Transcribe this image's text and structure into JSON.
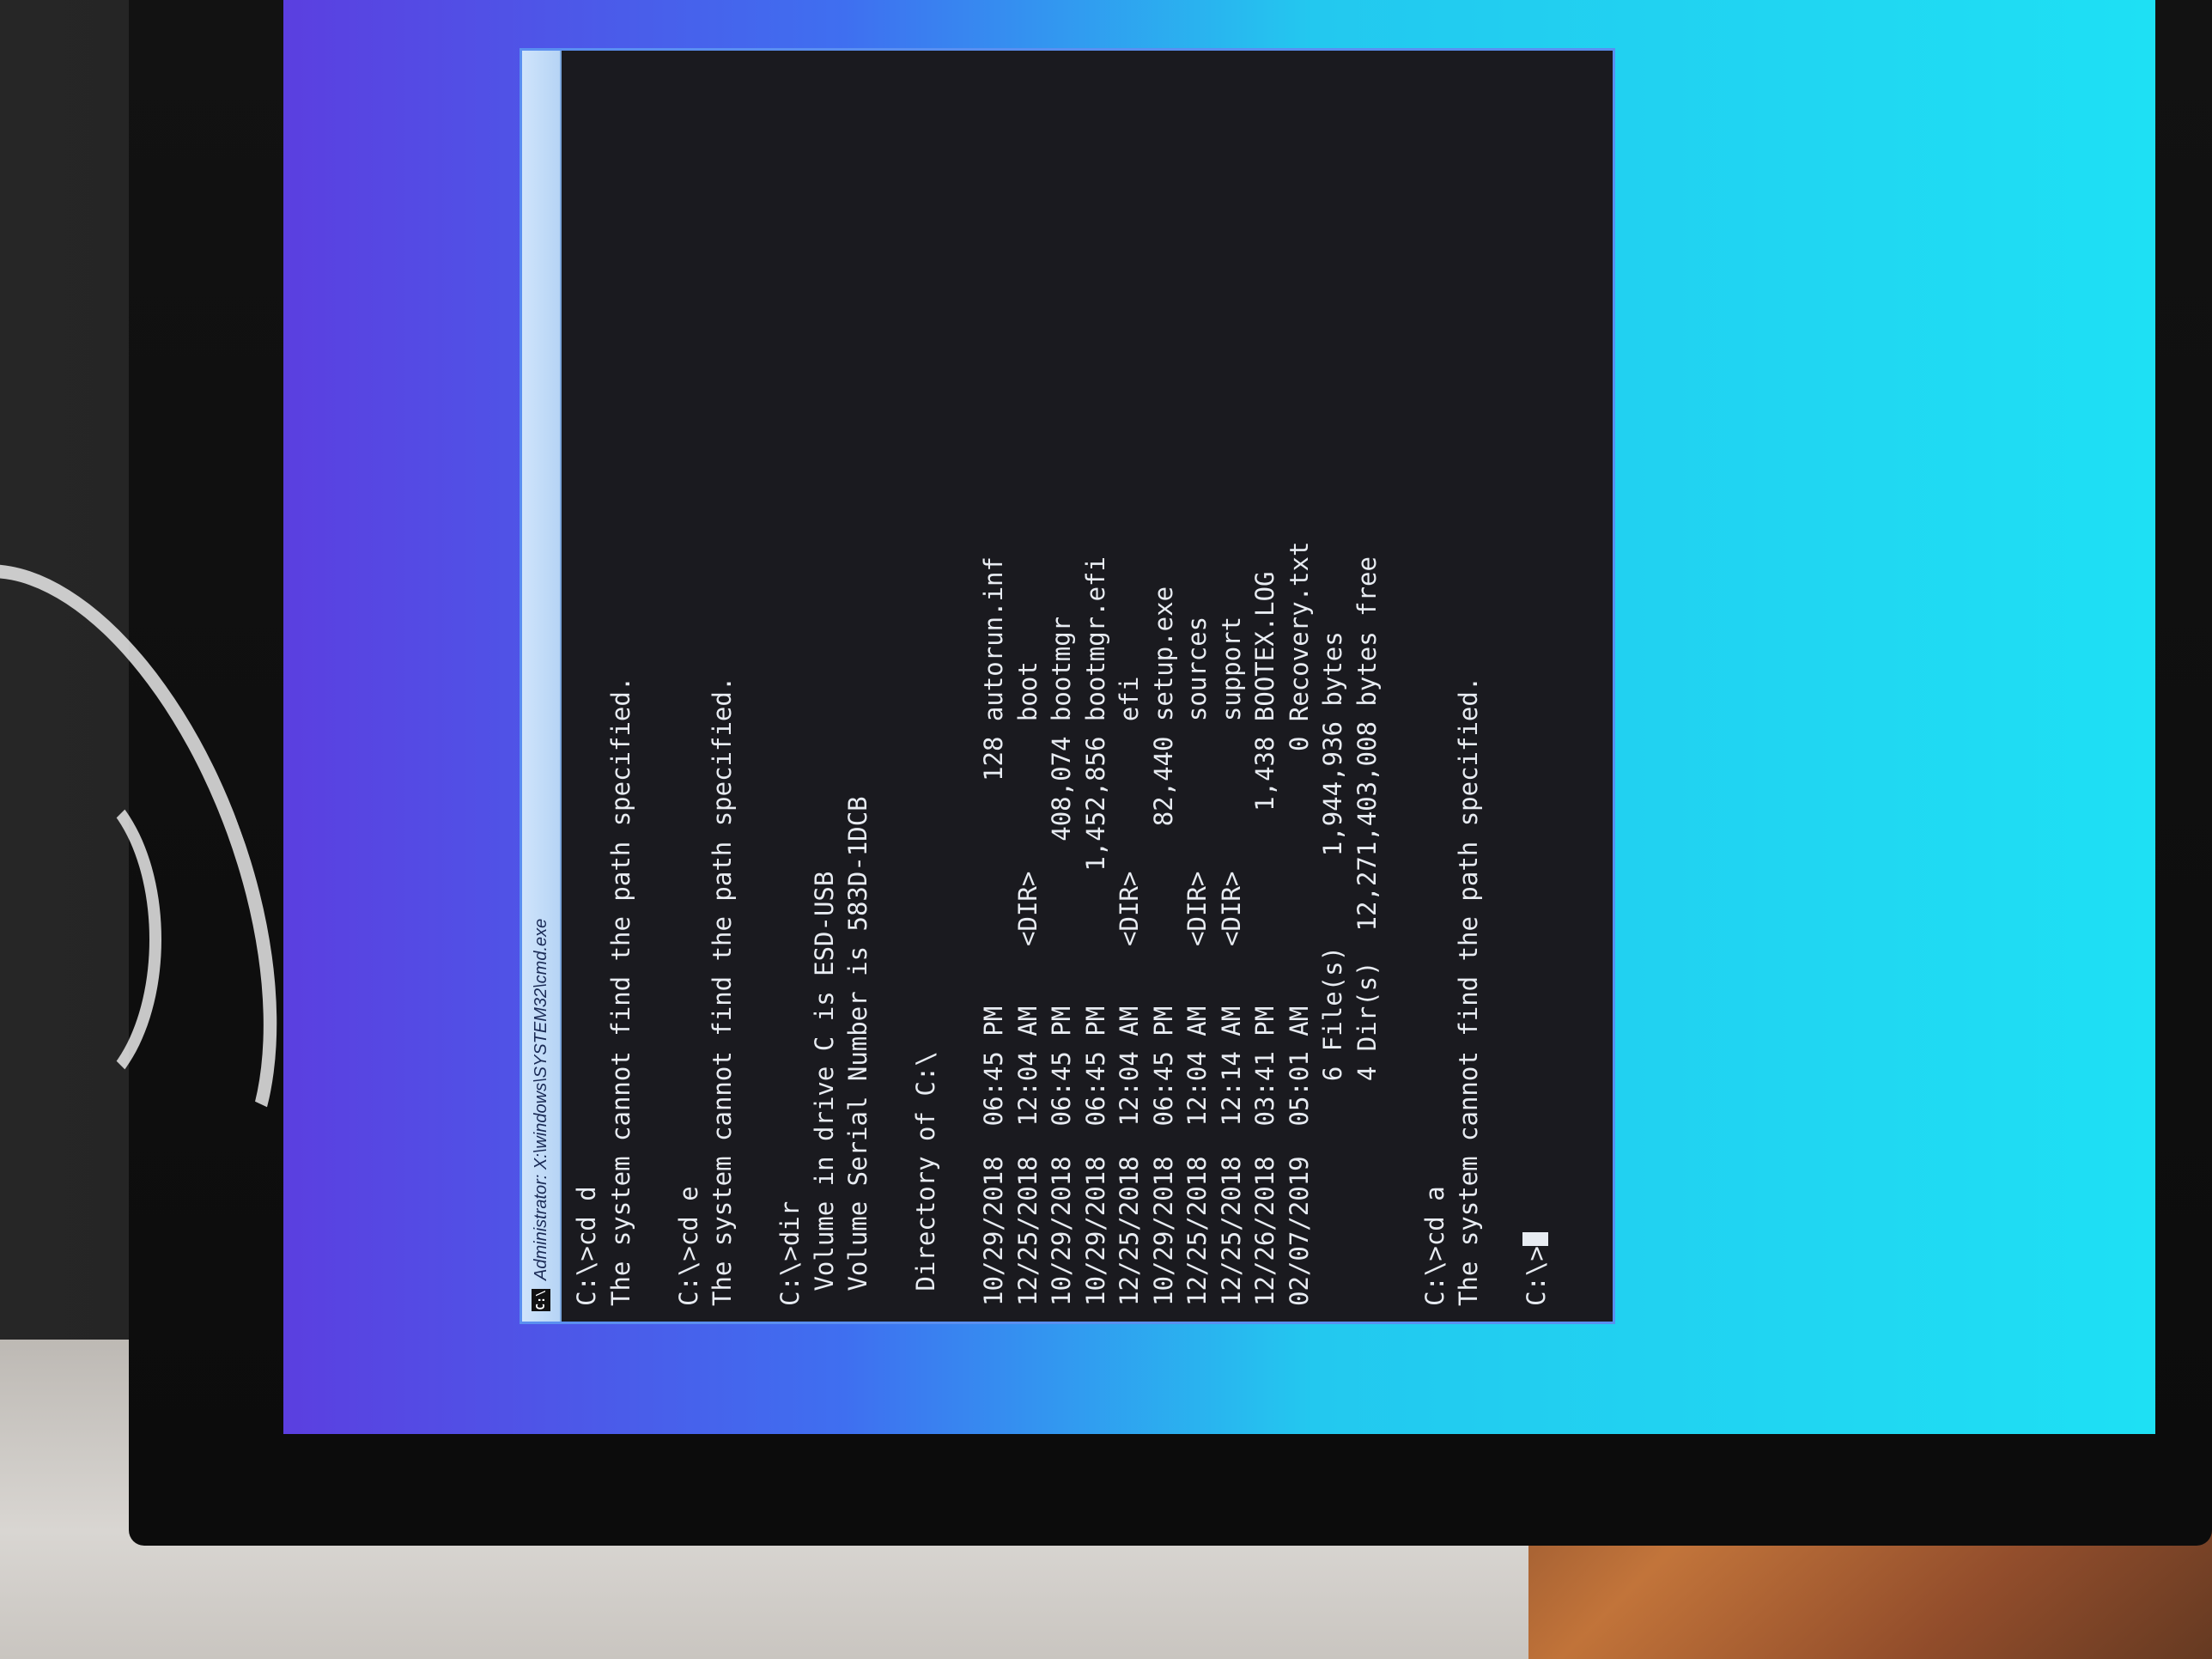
{
  "window": {
    "title": "Administrator: X:\\windows\\SYSTEM32\\cmd.exe",
    "icon_label": "C:\\"
  },
  "console": {
    "lines": [
      "C:\\>cd d",
      "The system cannot find the path specified.",
      "",
      "C:\\>cd e",
      "The system cannot find the path specified.",
      "",
      "C:\\>dir",
      " Volume in drive C is ESD-USB",
      " Volume Serial Number is 583D-1DCB",
      "",
      " Directory of C:\\",
      "",
      "10/29/2018  06:45 PM               128 autorun.inf",
      "12/25/2018  12:04 AM    <DIR>          boot",
      "10/29/2018  06:45 PM           408,074 bootmgr",
      "10/29/2018  06:45 PM         1,452,856 bootmgr.efi",
      "12/25/2018  12:04 AM    <DIR>          efi",
      "10/29/2018  06:45 PM            82,440 setup.exe",
      "12/25/2018  12:04 AM    <DIR>          sources",
      "12/25/2018  12:14 AM    <DIR>          support",
      "12/26/2018  03:41 PM             1,438 BOOTEX.LOG",
      "02/07/2019  05:01 AM                 0 Recovery.txt",
      "               6 File(s)      1,944,936 bytes",
      "               4 Dir(s)  12,271,403,008 bytes free",
      "",
      "C:\\>cd a",
      "The system cannot find the path specified.",
      "",
      "C:\\>"
    ]
  },
  "colors": {
    "console_bg": "#1a1a1f",
    "console_text": "#e8ecf2",
    "titlebar": "#cfe4fb",
    "screen_accent": "#23c8ef"
  }
}
